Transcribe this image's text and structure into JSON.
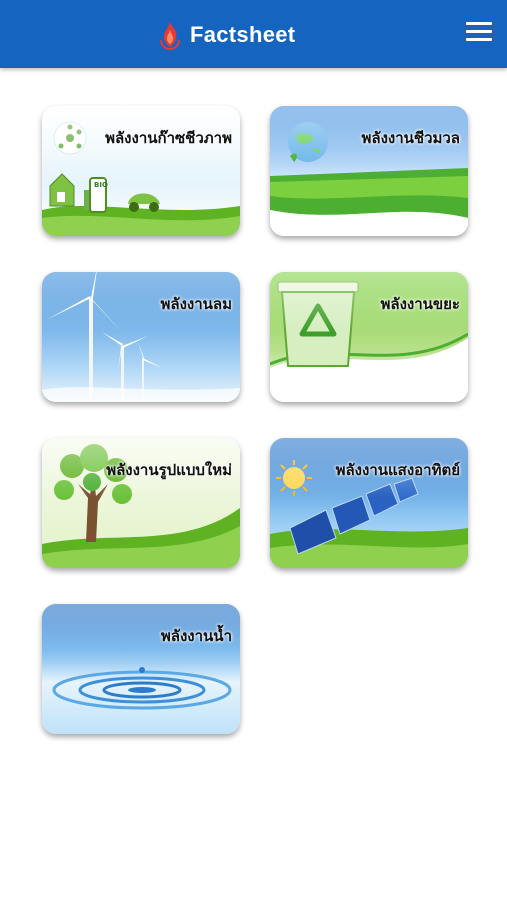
{
  "header": {
    "title": "Factsheet",
    "logo_icon": "flame-logo-icon",
    "menu_icon": "hamburger-menu-icon",
    "bar_color": "#1565c0"
  },
  "tiles": [
    {
      "label": "พลังงานก๊าซชีวภาพ",
      "badge": "BIO"
    },
    {
      "label": "พลังงานชีวมวล"
    },
    {
      "label": "พลังงานลม"
    },
    {
      "label": "พลังงานขยะ"
    },
    {
      "label": "พลังงานรูปแบบใหม่"
    },
    {
      "label": "พลังงานแสงอาทิตย์"
    },
    {
      "label": "พลังงานน้ำ"
    }
  ]
}
